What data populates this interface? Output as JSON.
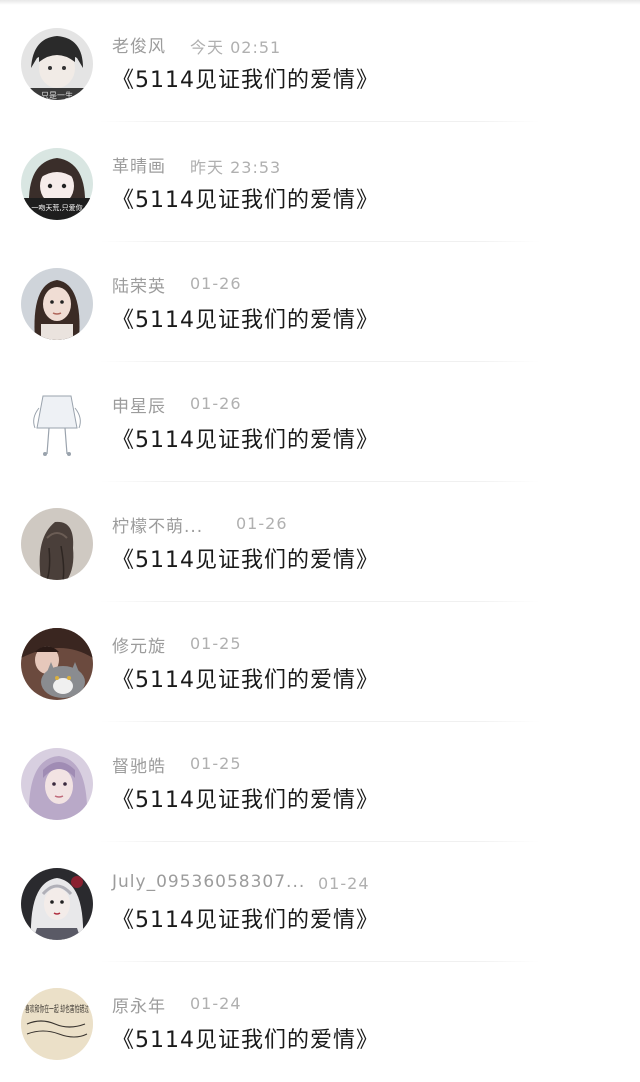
{
  "comments": [
    {
      "name": "老俊风",
      "time": "今天 02:51",
      "message": "《5114见证我们的爱情》",
      "avatar_text": "只是一生",
      "avatar_bg": "#e4e4e4",
      "avatar_fg": "#2a2a2a",
      "avatar_icon": "avatar-boy-icon"
    },
    {
      "name": "革晴画",
      "time": "昨天 23:53",
      "message": "《5114见证我们的爱情》",
      "avatar_text": "一吻天荒,只爱你",
      "avatar_bg": "#d9e6e2",
      "avatar_fg": "#3a2e2a",
      "avatar_icon": "avatar-girl-icon"
    },
    {
      "name": "陆荣英",
      "time": "01-26",
      "message": "《5114见证我们的爱情》",
      "avatar_bg": "#cfd4da",
      "avatar_fg": "#3b2b25",
      "avatar_icon": "avatar-woman-icon"
    },
    {
      "name": "申星辰",
      "time": "01-26",
      "message": "《5114见证我们的爱情》",
      "avatar_bg": "#ffffff",
      "avatar_fg": "#9aa3ad",
      "avatar_icon": "avatar-sketch-icon"
    },
    {
      "name": "柠檬不萌...",
      "time": "01-26",
      "message": "《5114见证我们的爱情》",
      "avatar_bg": "#cfc9c2",
      "avatar_fg": "#4a3f3a",
      "avatar_icon": "avatar-longhair-icon"
    },
    {
      "name": "修元旋",
      "time": "01-25",
      "message": "《5114见证我们的爱情》",
      "avatar_bg": "#6b4a3e",
      "avatar_fg": "#d9c6bc",
      "avatar_icon": "avatar-cat-icon"
    },
    {
      "name": "督驰皓",
      "time": "01-25",
      "message": "《5114见证我们的爱情》",
      "avatar_bg": "#b9a9c8",
      "avatar_fg": "#8a6f9e",
      "avatar_icon": "avatar-purplehair-icon"
    },
    {
      "name": "July_09536058307...",
      "time": "01-24",
      "message": "《5114见证我们的爱情》",
      "avatar_bg": "#2a2a2e",
      "avatar_fg": "#e8e8ea",
      "avatar_icon": "avatar-fantasy-icon"
    },
    {
      "name": "原永年",
      "time": "01-24",
      "message": "《5114见证我们的爱情》",
      "avatar_text": "喜欢和你在一起 却也害怕错过",
      "avatar_bg": "#efe5cf",
      "avatar_fg": "#3a3530",
      "avatar_icon": "avatar-handwriting-icon"
    }
  ]
}
